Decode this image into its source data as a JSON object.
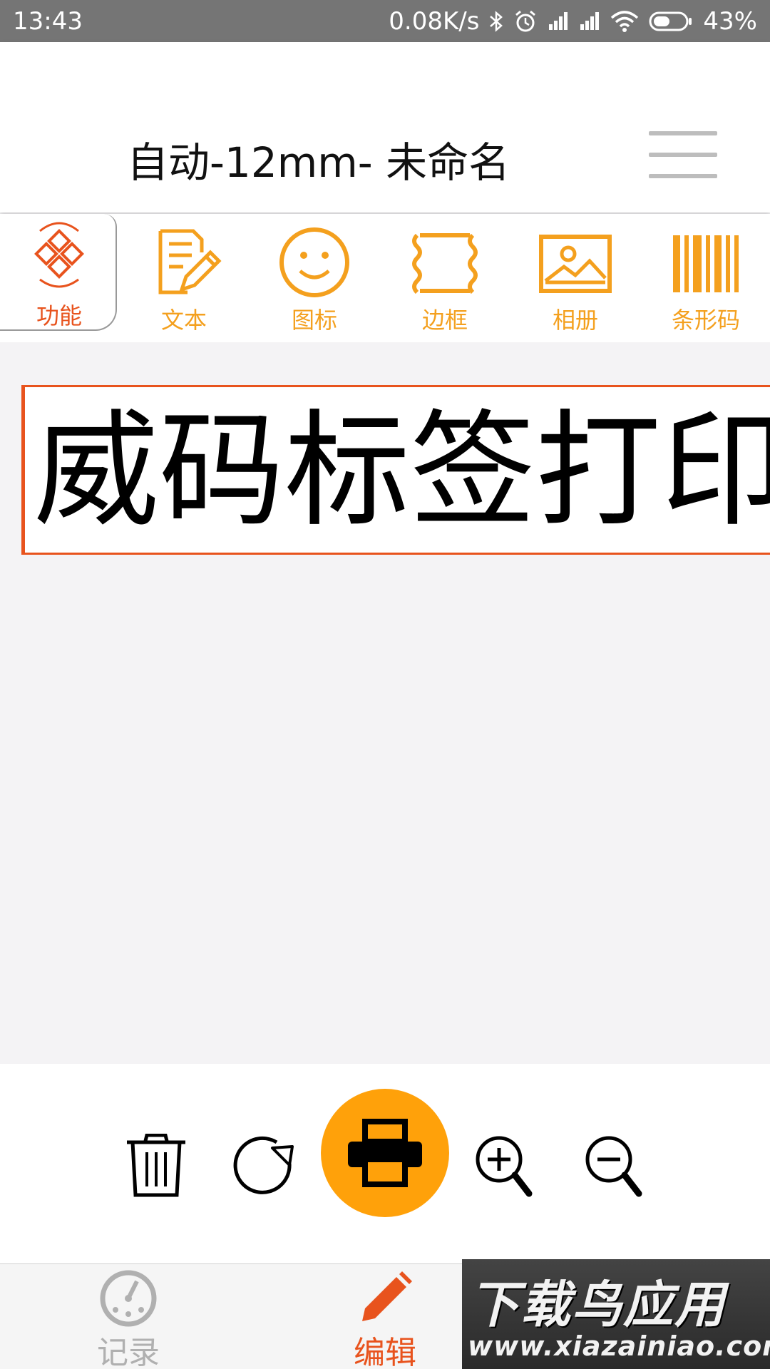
{
  "status_bar": {
    "time": "13:43",
    "net_speed": "0.08K/s",
    "battery": "43%",
    "icons": [
      "bluetooth-icon",
      "alarm-icon",
      "signal-icon",
      "signal-icon",
      "wifi-icon",
      "battery-icon"
    ]
  },
  "header": {
    "title": "自动-12mm- 未命名",
    "menu_icon": "hamburger-menu-icon"
  },
  "toolbar": {
    "items": [
      {
        "label": "功能",
        "icon": "function-diamond-icon"
      },
      {
        "label": "文本",
        "icon": "text-edit-icon"
      },
      {
        "label": "图标",
        "icon": "smiley-icon"
      },
      {
        "label": "边框",
        "icon": "border-frame-icon"
      },
      {
        "label": "相册",
        "icon": "photo-album-icon"
      },
      {
        "label": "条形码",
        "icon": "barcode-icon"
      }
    ]
  },
  "canvas": {
    "label_text": "威码标签打印"
  },
  "actions": {
    "items": [
      "trash-icon",
      "rotate-icon",
      "printer-icon",
      "zoom-in-icon",
      "zoom-out-icon"
    ]
  },
  "bottom_nav": {
    "items": [
      {
        "label": "记录",
        "icon": "records-clock-icon"
      },
      {
        "label": "编辑",
        "icon": "pencil-icon"
      }
    ]
  },
  "watermark": {
    "title": "下载鸟应用",
    "url": "www.xiazainiao.com"
  },
  "colors": {
    "accent_orange": "#ffa10a",
    "accent_red": "#e8531d",
    "status_bar": "#757575"
  }
}
